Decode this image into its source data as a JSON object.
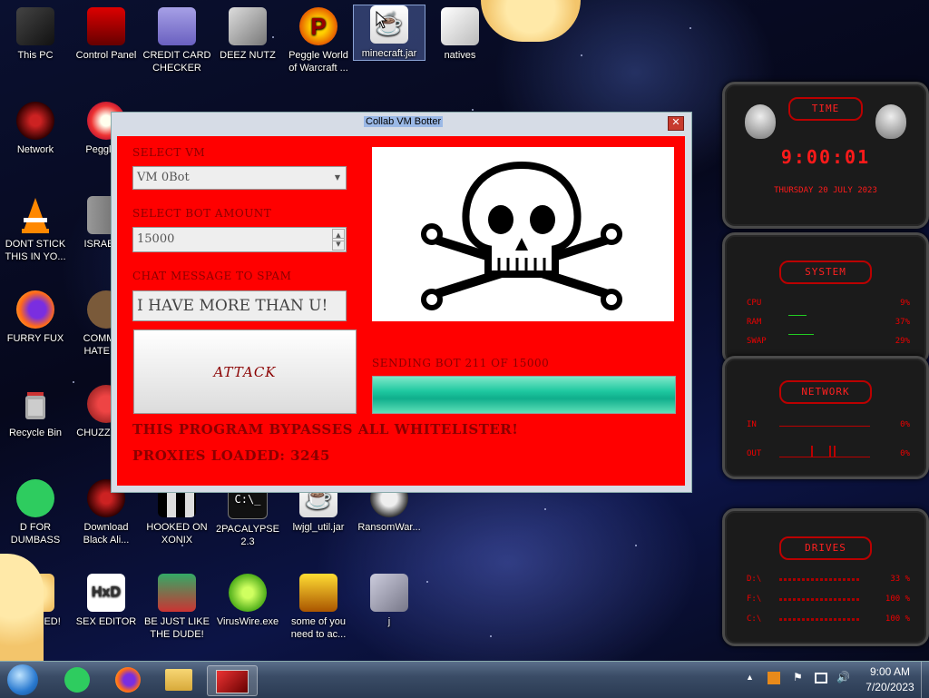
{
  "desktop_icons": [
    {
      "label": "This PC"
    },
    {
      "label": "Control Panel"
    },
    {
      "label": "CREDIT CARD\nCHECKER"
    },
    {
      "label": "DEEZ NUTZ"
    },
    {
      "label": "Peggle World of Warcraft ..."
    },
    {
      "label": "minecraft.jar"
    },
    {
      "label": "natives"
    },
    {
      "label": "Network"
    },
    {
      "label": "Peggle D"
    },
    {
      "label": "DONT STICK THIS IN YO..."
    },
    {
      "label": "ISRAEL S"
    },
    {
      "label": "FURRY FUX"
    },
    {
      "label": "COMMUN HATE THI"
    },
    {
      "label": "Recycle Bin"
    },
    {
      "label": "CHUZZ CUM"
    },
    {
      "label": "D FOR DUMBASS"
    },
    {
      "label": "Download Black Ali..."
    },
    {
      "label": "HOOKED ON XONIX"
    },
    {
      "label": "2PACALYPSE 2.3"
    },
    {
      "label": "lwjgl_util.jar"
    },
    {
      "label": "RansomWar..."
    },
    {
      "label": "USED!"
    },
    {
      "label": "SEX EDITOR"
    },
    {
      "label": "BE JUST LIKE THE DUDE!"
    },
    {
      "label": "VirusWire.exe"
    },
    {
      "label": "some of you need to ac..."
    },
    {
      "label": "j"
    }
  ],
  "bot_window": {
    "title": "Collab VM Botter",
    "close": "✕",
    "select_vm_label": "SELECT VM",
    "select_vm_value": "VM 0Bot",
    "select_bot_amount_label": "SELECT BOT AMOUNT",
    "bot_amount_value": "15000",
    "chat_message_label": "CHAT MESSAGE TO SPAM",
    "chat_message_value": "I HAVE MORE THAN U!",
    "attack_button": "ATTACK",
    "status_text": "SENDING BOT 211 OF 15000",
    "progress": 1.0,
    "bypass_text": "THIS PROGRAM BYPASSES ALL WHITELISTER!",
    "proxies_text": "PROXIES LOADED: 3245"
  },
  "gadgets": {
    "time": {
      "title": "TIME",
      "clock": "9:00:01",
      "date": "THURSDAY 20 JULY 2023"
    },
    "system": {
      "title": "SYSTEM",
      "rows": [
        {
          "label": "CPU",
          "value": "9%"
        },
        {
          "label": "RAM",
          "value": "37%"
        },
        {
          "label": "SWAP",
          "value": "29%"
        }
      ]
    },
    "network": {
      "title": "NETWORK",
      "rows": [
        {
          "label": "IN",
          "value": "0%"
        },
        {
          "label": "OUT",
          "value": "0%"
        }
      ]
    },
    "drives": {
      "title": "DRIVES",
      "rows": [
        {
          "label": "D:\\",
          "value": "33 %"
        },
        {
          "label": "F:\\",
          "value": "100 %"
        },
        {
          "label": "C:\\",
          "value": "100 %"
        }
      ]
    }
  },
  "taskbar": {
    "time": "9:00 AM",
    "date": "7/20/2023"
  },
  "colors": {
    "panel_red": "#ff0000",
    "label_dark_red": "#8a0000",
    "gadget_red": "#ff2020"
  }
}
